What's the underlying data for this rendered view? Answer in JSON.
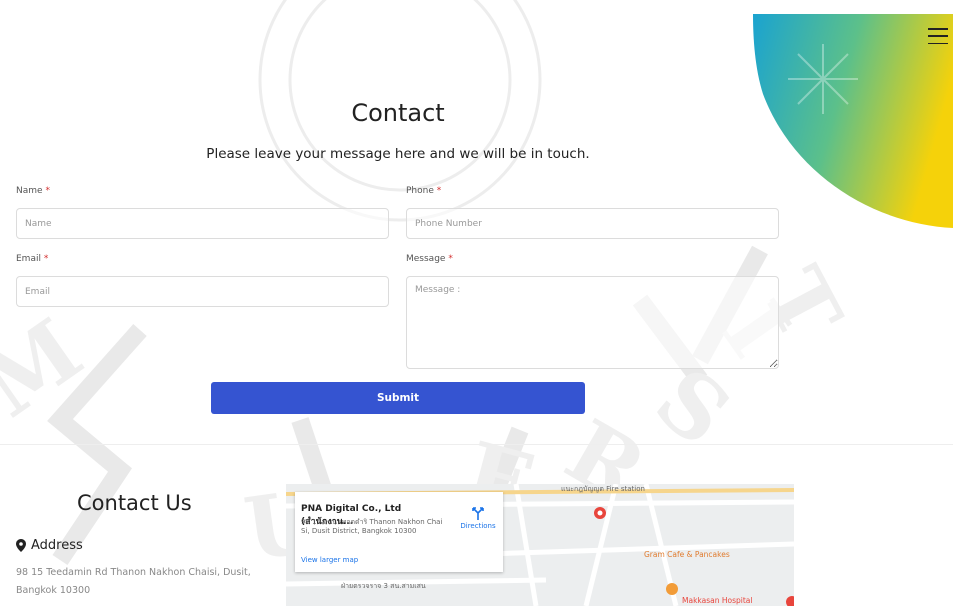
{
  "contact": {
    "title": "Contact",
    "subtitle": "Please leave your message here and we will be in touch.",
    "fields": {
      "name": {
        "label": "Name",
        "required_mark": "*",
        "placeholder": "Name"
      },
      "phone": {
        "label": "Phone",
        "required_mark": "*",
        "placeholder": "Phone Number"
      },
      "email": {
        "label": "Email",
        "required_mark": "*",
        "placeholder": "Email"
      },
      "message": {
        "label": "Message",
        "required_mark": "*",
        "placeholder": "Message :"
      }
    },
    "submit_label": "Submit"
  },
  "contact_us": {
    "title": "Contact Us",
    "address_heading": "Address",
    "address_text": "98 15 Teedamin Rd Thanon Nakhon Chaisi, Dusit, Bangkok 10300"
  },
  "map": {
    "place_name": "PNA Digital Co., Ltd (สำนักงาน...",
    "place_address": "98 15 ถนน เทอดดำริ Thanon Nakhon Chai Si, Dusit District, Bangkok 10300",
    "directions_label": "Directions",
    "view_larger_label": "View larger map",
    "poi_1": "Gram Cafe & Pancakes",
    "poi_2": "Makkasan Hospital",
    "label_1": "แนะกฎบัญญต Fire station",
    "label_2": "ฝ่ายตรวจราจ 3 สน.สามเสน"
  },
  "colors": {
    "accent": "#3554d1",
    "required": "#d32f2f",
    "deco_from": "#1aa3d0",
    "deco_mid": "#5cc08a",
    "deco_to": "#f5d20a"
  },
  "icons": {
    "menu": "hamburger-icon",
    "address": "map-pin-icon",
    "directions": "directions-icon"
  }
}
